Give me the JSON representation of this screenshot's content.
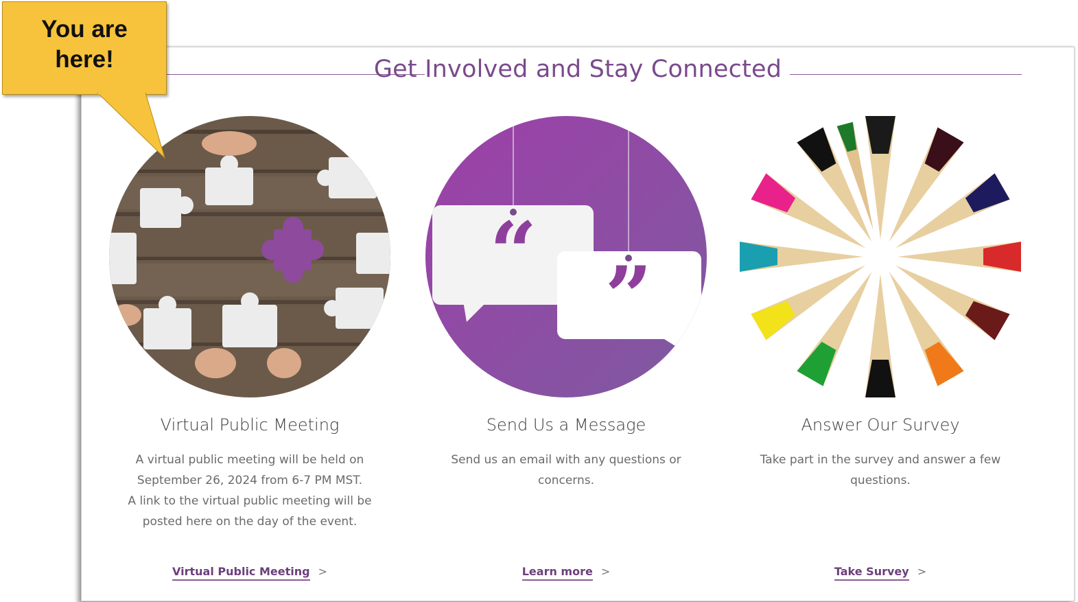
{
  "callout": {
    "text_line1": "You are",
    "text_line2": "here!"
  },
  "section": {
    "title": "Get Involved and Stay Connected"
  },
  "cards": [
    {
      "title": "Virtual Public Meeting",
      "description_lines": [
        "A virtual public meeting will be held on",
        "September 26, 2024 from 6-7 PM MST.",
        "A link to the virtual public meeting will be",
        "posted here on the day of the event."
      ],
      "link": "Virtual Public Meeting",
      "image_icon": "puzzle-pieces-icon"
    },
    {
      "title": "Send Us a Message",
      "description_lines": [
        "Send us an email with any questions or",
        "concerns."
      ],
      "link": "Learn more",
      "image_icon": "quote-bubbles-icon"
    },
    {
      "title": "Answer Our Survey",
      "description_lines": [
        "Take part in the survey and answer a few",
        "questions."
      ],
      "link": "Take Survey",
      "image_icon": "colored-pencils-icon"
    }
  ],
  "link_chevron": ">",
  "colors": {
    "accent": "#7a4a8c",
    "callout": "#f8c33c",
    "purple_circle": "#9b4fa7"
  }
}
